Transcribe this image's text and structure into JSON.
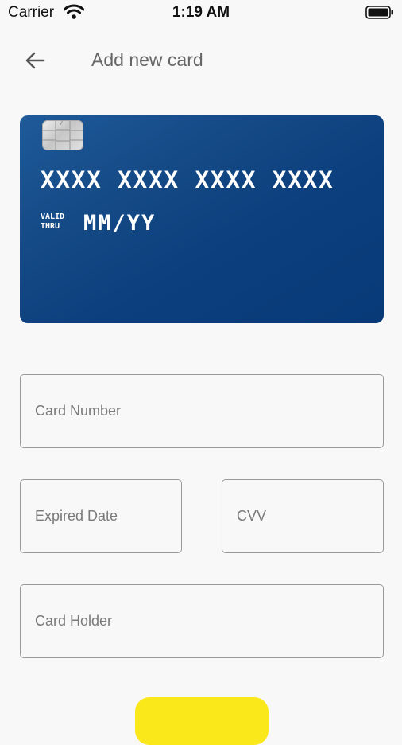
{
  "status_bar": {
    "carrier": "Carrier",
    "time": "1:19 AM"
  },
  "header": {
    "title": "Add new card",
    "back_icon": "arrow-left-icon"
  },
  "card_preview": {
    "number": "XXXX XXXX XXXX XXXX",
    "valid_line1": "VALID",
    "valid_line2": "THRU",
    "expiry": "MM/YY",
    "gradient_colors": [
      "#1f5a99",
      "#083a78"
    ]
  },
  "form": {
    "card_number_placeholder": "Card Number",
    "expired_date_placeholder": "Expired Date",
    "cvv_placeholder": "CVV",
    "card_holder_placeholder": "Card Holder"
  },
  "colors": {
    "accent": "#fbe81b",
    "background": "#f8f8f8"
  }
}
